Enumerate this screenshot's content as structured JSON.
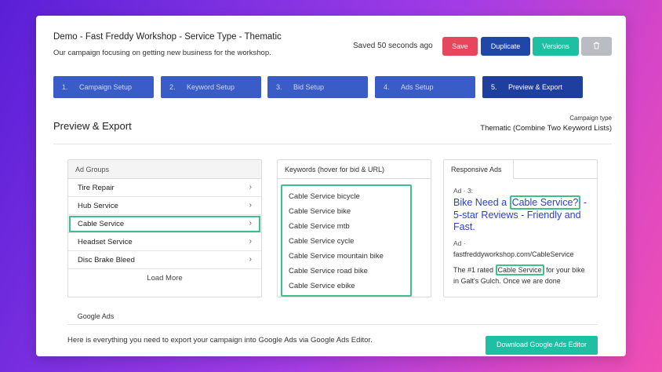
{
  "header": {
    "title": "Demo - Fast Freddy Workshop - Service Type - Thematic",
    "subtitle": "Our campaign focusing on getting new business for the workshop.",
    "saved_status": "Saved 50 seconds ago",
    "buttons": {
      "save": "Save",
      "duplicate": "Duplicate",
      "versions": "Versions"
    }
  },
  "steps": [
    {
      "num": "1.",
      "label": "Campaign Setup"
    },
    {
      "num": "2.",
      "label": "Keyword Setup"
    },
    {
      "num": "3.",
      "label": "Bid Setup"
    },
    {
      "num": "4.",
      "label": "Ads Setup"
    },
    {
      "num": "5.",
      "label": "Preview & Export"
    }
  ],
  "section": {
    "title": "Preview & Export",
    "campaign_type_label": "Campaign type",
    "campaign_type_value": "Thematic (Combine Two Keyword Lists)"
  },
  "ad_groups": {
    "header": "Ad Groups",
    "items": [
      "Tire Repair",
      "Hub Service",
      "Cable Service",
      "Headset Service",
      "Disc Brake Bleed"
    ],
    "selected_index": 2,
    "load_more": "Load More"
  },
  "keywords": {
    "header": "Keywords (hover for bid & URL)",
    "items": [
      "Cable Service bicycle",
      "Cable Service bike",
      "Cable Service mtb",
      "Cable Service cycle",
      "Cable Service mountain bike",
      "Cable Service road bike",
      "Cable Service ebike"
    ]
  },
  "responsive_ads": {
    "tab": "Responsive Ads",
    "ad_label": "Ad · 3:",
    "headline_pre": "Bike Need a ",
    "headline_highlight": "Cable Service?",
    "headline_post": " - 5-star Reviews - Friendly and Fast.",
    "meta": "Ad ·",
    "url": "fastfreddyworkshop.com/CableService",
    "desc_pre": "The #1 rated ",
    "desc_highlight": "Cable Service",
    "desc_post": " for your bike in Galt's Gulch. Once we are done"
  },
  "google_ads": {
    "tab": "Google Ads",
    "export_text": "Here is everything you need to export your campaign into Google Ads via Google Ads Editor.",
    "download_button": "Download Google Ads Editor"
  },
  "colors": {
    "save": "#e5485d",
    "duplicate": "#1f47a8",
    "versions": "#1fbfa3",
    "step": "#3a5cc7",
    "step_active": "#1f3f9e",
    "highlight": "#3fbf8c",
    "ad_headline": "#2b3fd1"
  },
  "icons": {
    "delete": "trash-icon",
    "chevron": "chevron-right-icon"
  }
}
